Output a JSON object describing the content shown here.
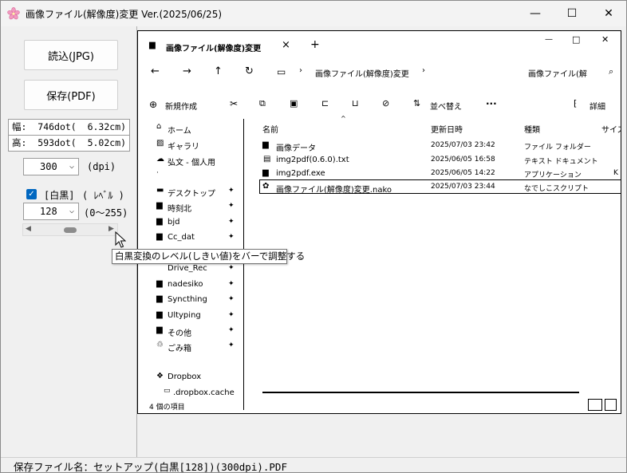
{
  "window": {
    "title": "画像ファイル(解像度)変更 Ver.(2025/06/25)",
    "minimize": "—",
    "maximize": "☐",
    "close": "✕"
  },
  "left": {
    "read_button": "読込(JPG)",
    "save_button": "保存(PDF)",
    "width_info": "幅:  746dot(  6.32cm)",
    "height_info": "高:  593dot(  5.02cm)",
    "dpi_value": "300",
    "dpi_unit": "(dpi)",
    "bw_label": "[白黒]",
    "level_label": "( ﾚﾍﾞﾙ )",
    "bw_checked": true,
    "level_value": "128",
    "level_range": "(0〜255)",
    "tooltip": "白黒変換のレベル(しきい値)をバーで調整する",
    "level_fraction": 0.5
  },
  "preview": {
    "tab_title": "画像ファイル(解像度)変更",
    "tab_close": "×",
    "new_tab": "+",
    "win_min": "—",
    "win_max": "□",
    "win_close": "✕",
    "address": "画像ファイル(解像度)変更",
    "address_sep": "›",
    "search": "画像ファイル(解",
    "new_button": "新規作成",
    "sort_button": "並べ替え",
    "detail_button": "詳細",
    "more": "···",
    "columns": {
      "name": "名前",
      "date": "更新日時",
      "type": "種類",
      "size": "サイズ"
    },
    "files": [
      {
        "name": "画像データ",
        "date": "2025/07/03 23:42",
        "type": "ファイル フォルダー"
      },
      {
        "name": "img2pdf(0.6.0).txt",
        "date": "2025/06/05 16:58",
        "type": "テキスト ドキュメント"
      },
      {
        "name": "img2pdf.exe",
        "date": "2025/06/05 14:22",
        "type": "アプリケーション"
      },
      {
        "name": "画像ファイル(解像度)変更.nako",
        "date": "2025/07/03 23:44",
        "type": "なでしこスクリプト"
      }
    ],
    "nav": [
      "ホーム",
      "ギャラリ",
      "弘文 - 個人用",
      "デスクトップ",
      "時刻北",
      "bjd",
      "Cc_dat",
      "Drive_Rec",
      "nadesiko",
      "Syncthing",
      "Ultyping",
      "その他",
      "ごみ箱",
      "Dropbox",
      ".dropbox.cache"
    ],
    "status": "4 個の項目"
  },
  "status_bar": {
    "text": "保存ファイル名：セットアップ(白黒[128])(300dpi).PDF"
  }
}
